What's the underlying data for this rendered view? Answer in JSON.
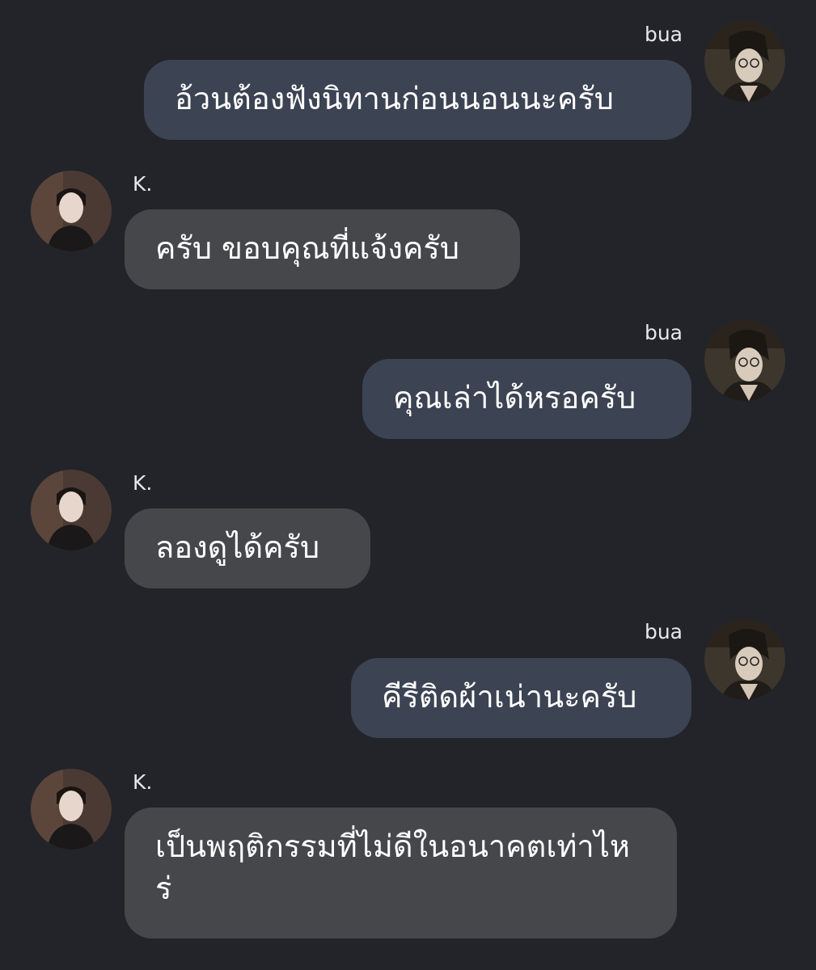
{
  "conversation": {
    "messages": [
      {
        "sender": "bua",
        "side": "right",
        "text": "อ้วนต้องฟังนิทานก่อนนอนนะครับ",
        "avatar_icon": "user-photo-bua-icon"
      },
      {
        "sender": "K.",
        "side": "left",
        "text": "ครับ ขอบคุณที่แจ้งครับ",
        "avatar_icon": "user-photo-k-icon"
      },
      {
        "sender": "bua",
        "side": "right",
        "text": "คุณเล่าได้หรอครับ",
        "avatar_icon": "user-photo-bua-icon"
      },
      {
        "sender": "K.",
        "side": "left",
        "text": "ลองดูได้ครับ",
        "avatar_icon": "user-photo-k-icon"
      },
      {
        "sender": "bua",
        "side": "right",
        "text": "คีรีติดผ้าเน่านะครับ",
        "avatar_icon": "user-photo-bua-icon"
      },
      {
        "sender": "K.",
        "side": "left",
        "text": "เป็นพฤติกรรมที่ไม่ดีในอนาคตเท่าไหร่",
        "avatar_icon": "user-photo-k-icon"
      }
    ]
  },
  "colors": {
    "background": "#23242a",
    "outgoing_bubble": "#3c4352",
    "incoming_bubble": "#46474b",
    "text": "#ffffff"
  }
}
